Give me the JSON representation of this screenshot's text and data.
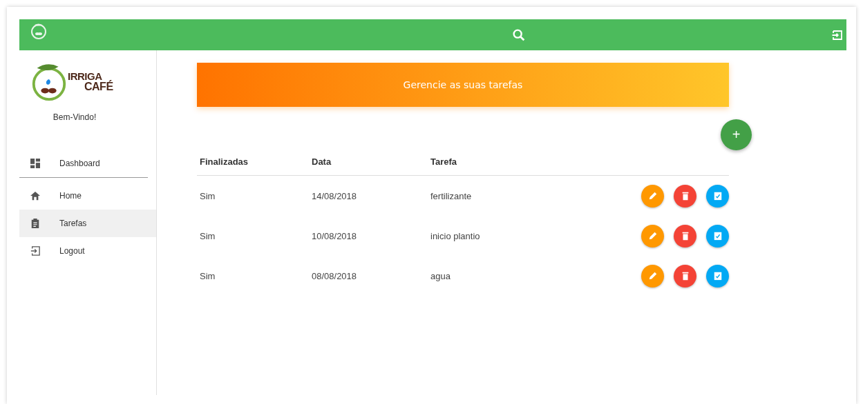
{
  "sidebar": {
    "logo": {
      "line_1": "IRRIGA",
      "line_2": "CAFÉ"
    },
    "greeting": "Bem-Vindo!",
    "items": [
      {
        "kind": "dashboard",
        "label": "Dashboard",
        "selected": false
      },
      {
        "kind": "home",
        "label": "Home",
        "selected": false
      },
      {
        "kind": "tasks",
        "label": "Tarefas",
        "selected": true
      },
      {
        "kind": "logout",
        "label": "Logout",
        "selected": false
      }
    ]
  },
  "banner": {
    "title": "Gerencie as suas tarefas"
  },
  "add_button": {
    "label": "+"
  },
  "table": {
    "columns": [
      "Finalizadas",
      "Data",
      "Tarefa"
    ],
    "rows": [
      {
        "cells": [
          "Sim",
          "14/08/2018",
          "fertilizante"
        ]
      },
      {
        "cells": [
          "Sim",
          "10/08/2018",
          "inicio plantio"
        ]
      },
      {
        "cells": [
          "Sim",
          "08/08/2018",
          "agua"
        ]
      }
    ]
  }
}
